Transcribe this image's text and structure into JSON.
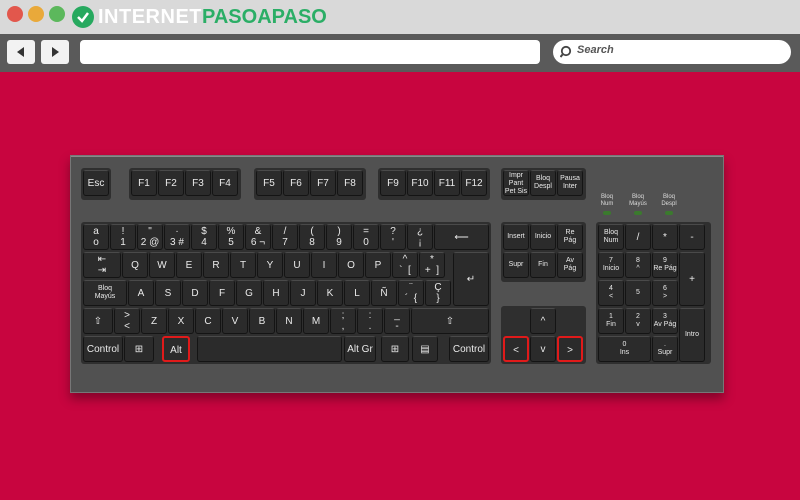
{
  "window": {
    "logo_part1": "InterneT",
    "logo_part2": "PasoaPaso"
  },
  "search": {
    "placeholder": "Search"
  },
  "keys": {
    "esc": "Esc",
    "f1": "F1",
    "f2": "F2",
    "f3": "F3",
    "f4": "F4",
    "f5": "F5",
    "f6": "F6",
    "f7": "F7",
    "f8": "F8",
    "f9": "F9",
    "f10": "F10",
    "f11": "F11",
    "f12": "F12",
    "prtsc": "Impr\nPant\nPet Sis",
    "scroll": "Bloq\nDespl",
    "pause": "Pausa\nInter",
    "grave": "a\no",
    "n1": "!\n1",
    "n2": "\"\n2 @",
    "n3": "·\n3 #",
    "n4": "$\n4",
    "n5": "%\n5",
    "n6": "&\n6 ¬",
    "n7": "/\n7",
    "n8": "(\n8",
    "n9": ")\n9",
    "n0": "=\n0",
    "apos": "?\n'",
    "iexcl": "¿\n¡",
    "backspace": "⟵",
    "tab": "⇤\n⇥",
    "q": "Q",
    "w": "W",
    "e": "E",
    "r": "R",
    "t": "T",
    "y": "Y",
    "u": "U",
    "i": "I",
    "o": "O",
    "p": "P",
    "grave2": "^\n`  [",
    "plus": "*\n+  ]",
    "enter": "↵",
    "caps": "Bloq\nMayús",
    "a": "A",
    "s": "S",
    "d": "D",
    "f": "F",
    "g": "G",
    "h": "H",
    "j": "J",
    "k": "K",
    "l": "L",
    "ntilde": "Ñ",
    "acute": "¨\n´  {",
    "ccedil": "Ç\n}",
    "lshift": "⇧",
    "angle": ">\n<",
    "z": "Z",
    "x": "X",
    "c": "C",
    "v": "V",
    "b": "B",
    "n": "N",
    "m": "M",
    "comma": ";\n,",
    "period": ":\n.",
    "minus": "_\n-",
    "rshift": "⇧",
    "lctrl": "Control",
    "lwin": "⊞",
    "alt": "Alt",
    "space": "",
    "altgr": "Alt Gr",
    "rwin": "⊞",
    "menu": "▤",
    "rctrl": "Control",
    "insert": "Insert",
    "home": "Inicio",
    "pgup": "Re\nPág",
    "delete": "Supr",
    "end": "Fin",
    "pgdn": "Av\nPág",
    "up": "^",
    "left": "<",
    "down": "v",
    "right": ">",
    "numlock": "Bloq\nNum",
    "ndiv": "/",
    "nmul": "*",
    "nsub": "-",
    "n7k": "7\nInicio",
    "n8k": "8\n^",
    "n9k": "9\nRe Pág",
    "nadd": "+",
    "n4k": "4\n<",
    "n5k": "5",
    "n6k": "6\n>",
    "n1k": "1\nFin",
    "n2k": "2\nv",
    "n3k": "3\nAv Pág",
    "nenter": "Intro",
    "n0k": "0\nIns",
    "ndot": ".\nSupr"
  },
  "leds": [
    "Bloq\nNum",
    "Bloq\nMayús",
    "Bloq\nDespl"
  ]
}
